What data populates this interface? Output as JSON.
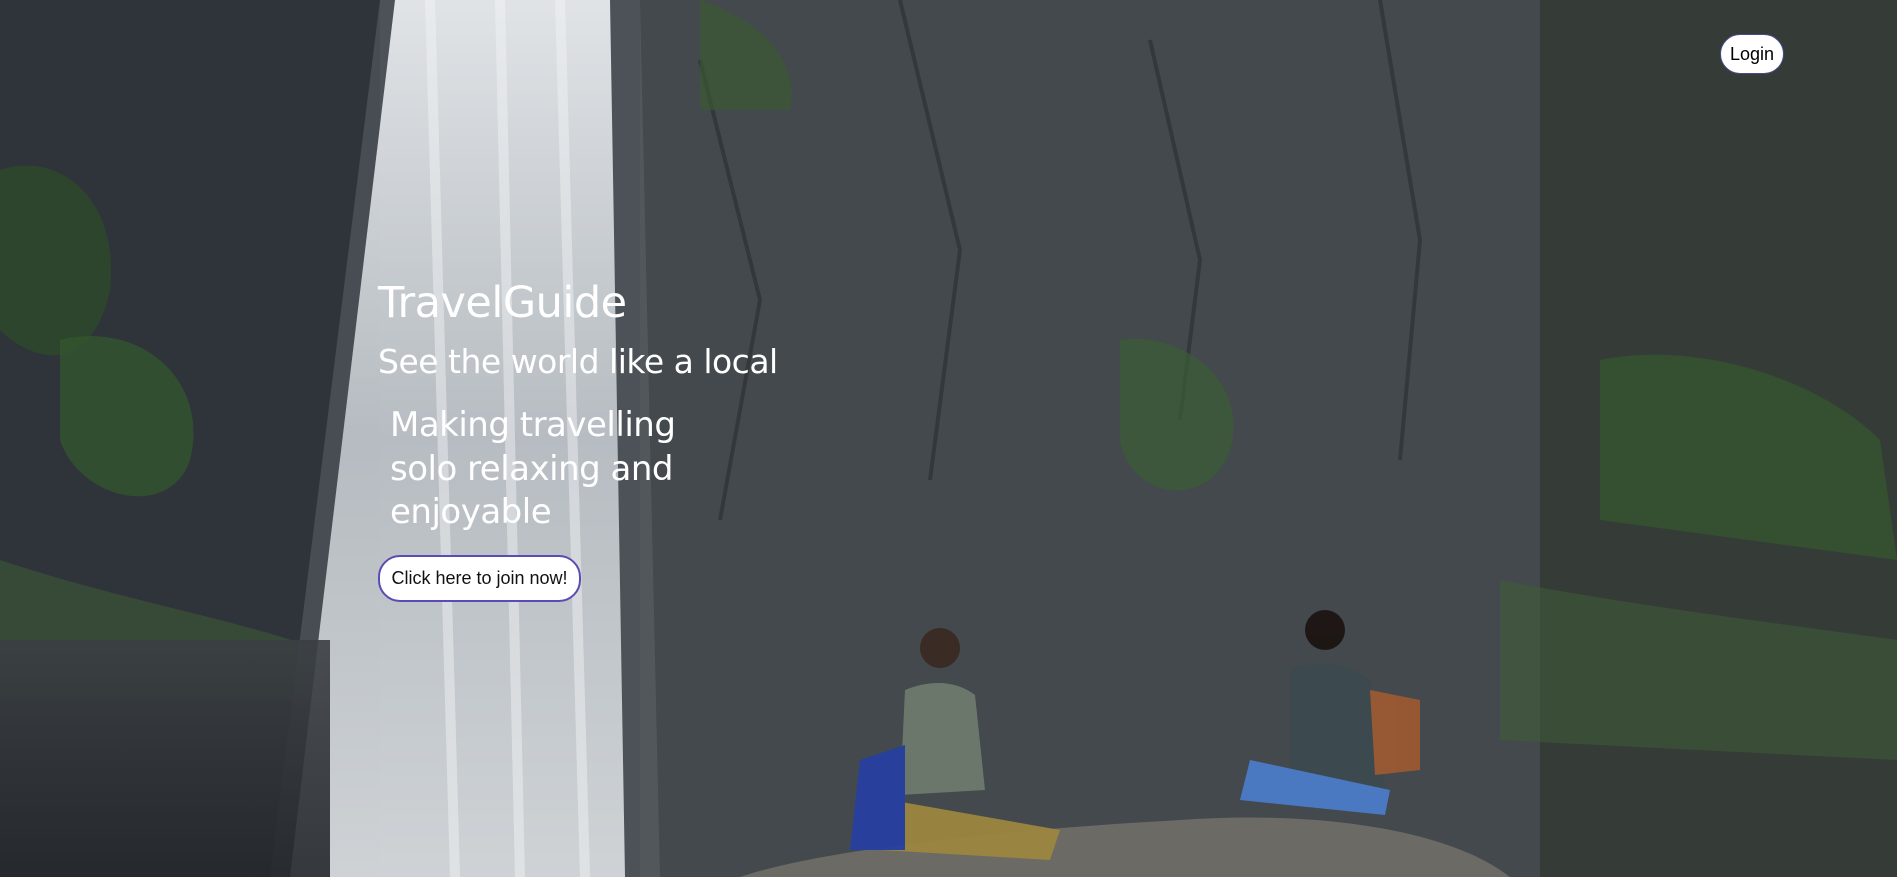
{
  "header": {
    "login_label": "Login"
  },
  "hero": {
    "title": "TravelGuide",
    "tagline": "See the world like a local",
    "description": "Making travelling solo relaxing and enjoyable",
    "cta_label": "Click here to join now!",
    "background_image": "waterfall-cliff-photo"
  },
  "colors": {
    "text": "#ffffff",
    "button_background": "#ffffff",
    "cta_border": "#5b4bb5",
    "login_border": "#4a4a8a"
  }
}
